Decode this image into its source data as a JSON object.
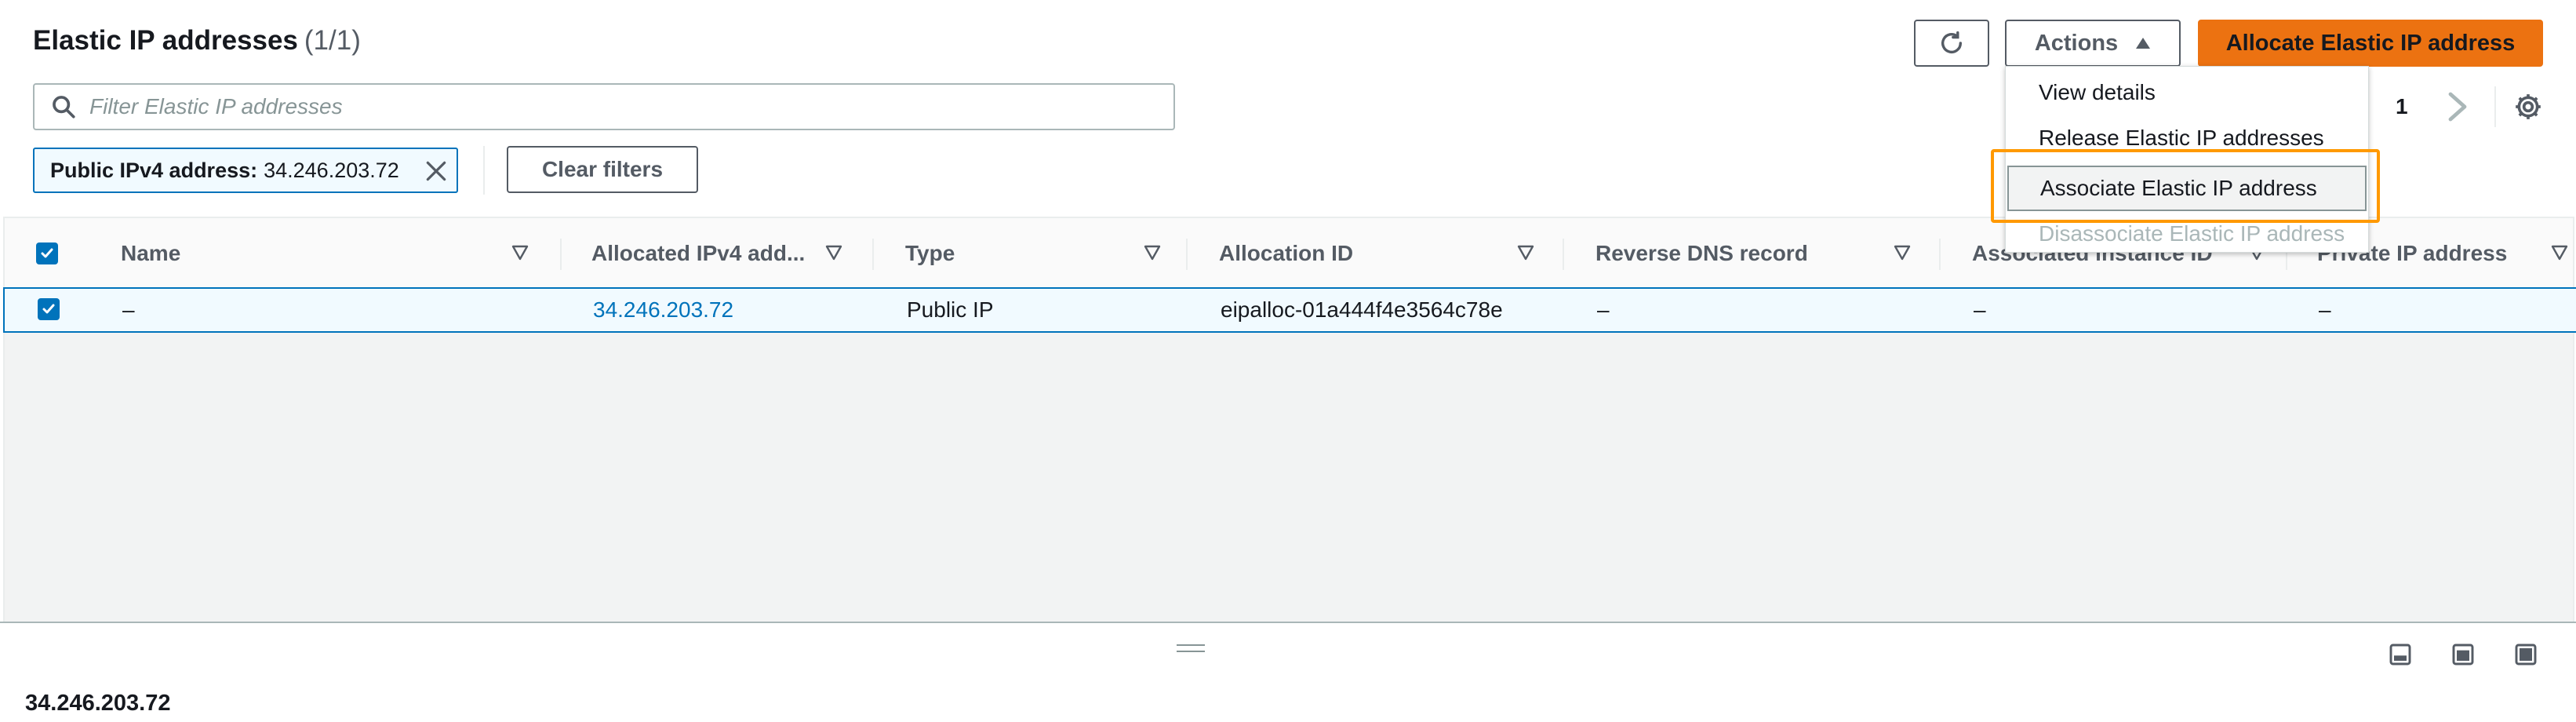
{
  "header": {
    "title": "Elastic IP addresses",
    "count": "(1/1)",
    "actions_label": "Actions",
    "allocate_label": "Allocate Elastic IP address"
  },
  "filter": {
    "placeholder": "Filter Elastic IP addresses",
    "value": ""
  },
  "token": {
    "key": "Public IPv4 address:",
    "value": "34.246.203.72"
  },
  "clear_filters_label": "Clear filters",
  "pagination": {
    "page": "1"
  },
  "table": {
    "columns": [
      "Name",
      "Allocated IPv4 add...",
      "Type",
      "Allocation ID",
      "Reverse DNS record",
      "Associated instance ID",
      "Private IP address"
    ],
    "rows": [
      {
        "name": "–",
        "ipv4": "34.246.203.72",
        "type": "Public IP",
        "allocation_id": "eipalloc-01a444f4e3564c78e",
        "reverse_dns": "–",
        "instance_id": "–",
        "private_ip": "–"
      }
    ]
  },
  "actions_menu": {
    "items": [
      "View details",
      "Release Elastic IP addresses",
      "Associate Elastic IP address",
      "Disassociate Elastic IP address"
    ]
  },
  "split_panel": {
    "title": "34.246.203.72"
  },
  "colors": {
    "accent": "#0073bb",
    "primary_button": "#ec7211",
    "highlight": "#ff9900"
  },
  "icons": [
    "refresh-icon",
    "caret-up-icon",
    "search-icon",
    "close-icon",
    "chevron-right-icon",
    "gear-icon",
    "sort-icon",
    "check-icon",
    "drag-handle-icon",
    "panel-bottom-icon",
    "panel-side-icon",
    "panel-full-icon"
  ]
}
